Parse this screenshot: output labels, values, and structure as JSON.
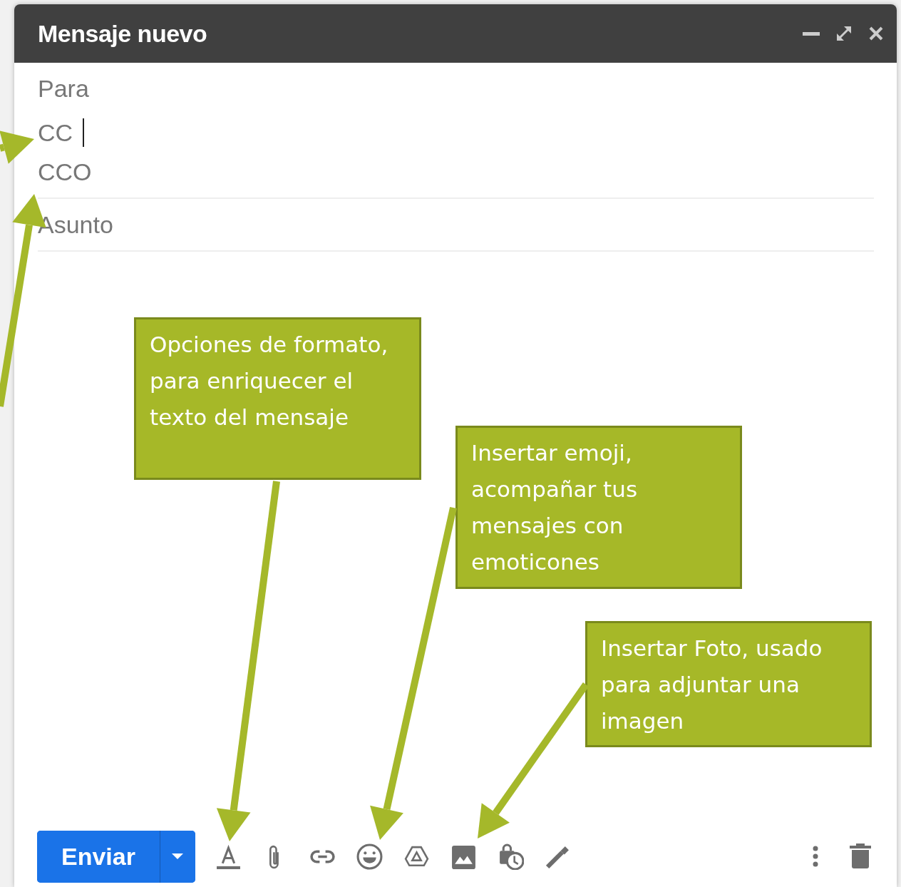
{
  "window": {
    "title": "Mensaje nuevo"
  },
  "fields": [
    {
      "placeholder": "Para",
      "focused": false
    },
    {
      "placeholder": "CC",
      "focused": true
    },
    {
      "placeholder": "CCO",
      "focused": false
    },
    {
      "placeholder": "Asunto",
      "focused": false
    }
  ],
  "send_button": {
    "label": "Enviar"
  },
  "callouts": [
    {
      "text": "Opciones de formato, para enriquecer el texto del mensaje"
    },
    {
      "text": "Insertar emoji, acompañar tus mensajes con emoticones"
    },
    {
      "text": "Insertar Foto, usado para adjuntar una imagen"
    }
  ]
}
